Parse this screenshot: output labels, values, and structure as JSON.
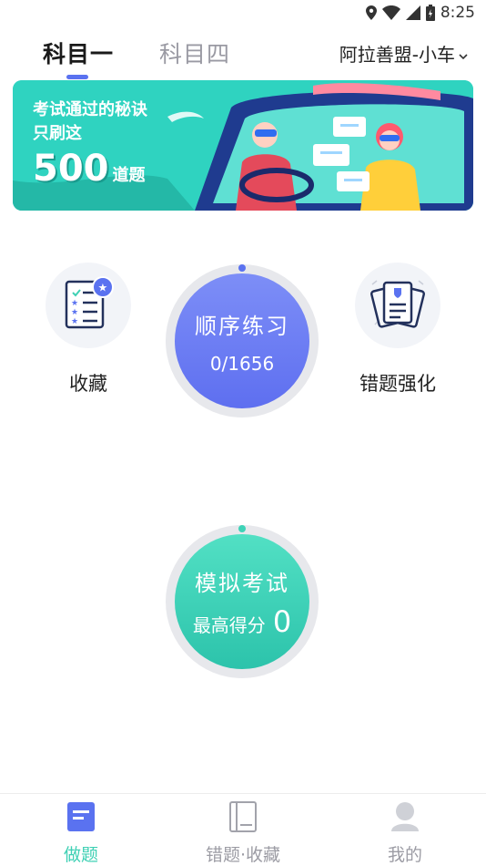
{
  "status_bar": {
    "time": "8:25",
    "icons": [
      "location-icon",
      "wifi-icon",
      "signal-icon",
      "battery-icon"
    ]
  },
  "top_nav": {
    "tabs": [
      {
        "label": "科目一",
        "active": true
      },
      {
        "label": "科目四",
        "active": false
      }
    ],
    "vehicle_selector": "阿拉善盟-小车",
    "accent_color": "#5a72f0"
  },
  "banner": {
    "line1": "考试通过的秘诀",
    "line2": "只刷这",
    "number": "500",
    "unit": "道题",
    "bg_color": "#2fd3c0"
  },
  "main": {
    "favorites": {
      "label": "收藏",
      "icon": "favorites-list-icon"
    },
    "mistakes": {
      "label": "错题强化",
      "icon": "mistake-cards-icon"
    },
    "sequential_practice": {
      "title": "顺序练习",
      "progress": "0/1656",
      "color": "#6b7ff5"
    },
    "mock_exam": {
      "title": "模拟考试",
      "score_label": "最高得分",
      "score": "0",
      "color": "#3dd3b7"
    }
  },
  "bottom_nav": {
    "items": [
      {
        "label": "做题",
        "icon": "practice-doc-icon",
        "active": true
      },
      {
        "label": "错题·收藏",
        "icon": "book-icon",
        "active": false
      },
      {
        "label": "我的",
        "icon": "profile-icon",
        "active": false
      }
    ],
    "active_color": "#3fd0b4"
  }
}
